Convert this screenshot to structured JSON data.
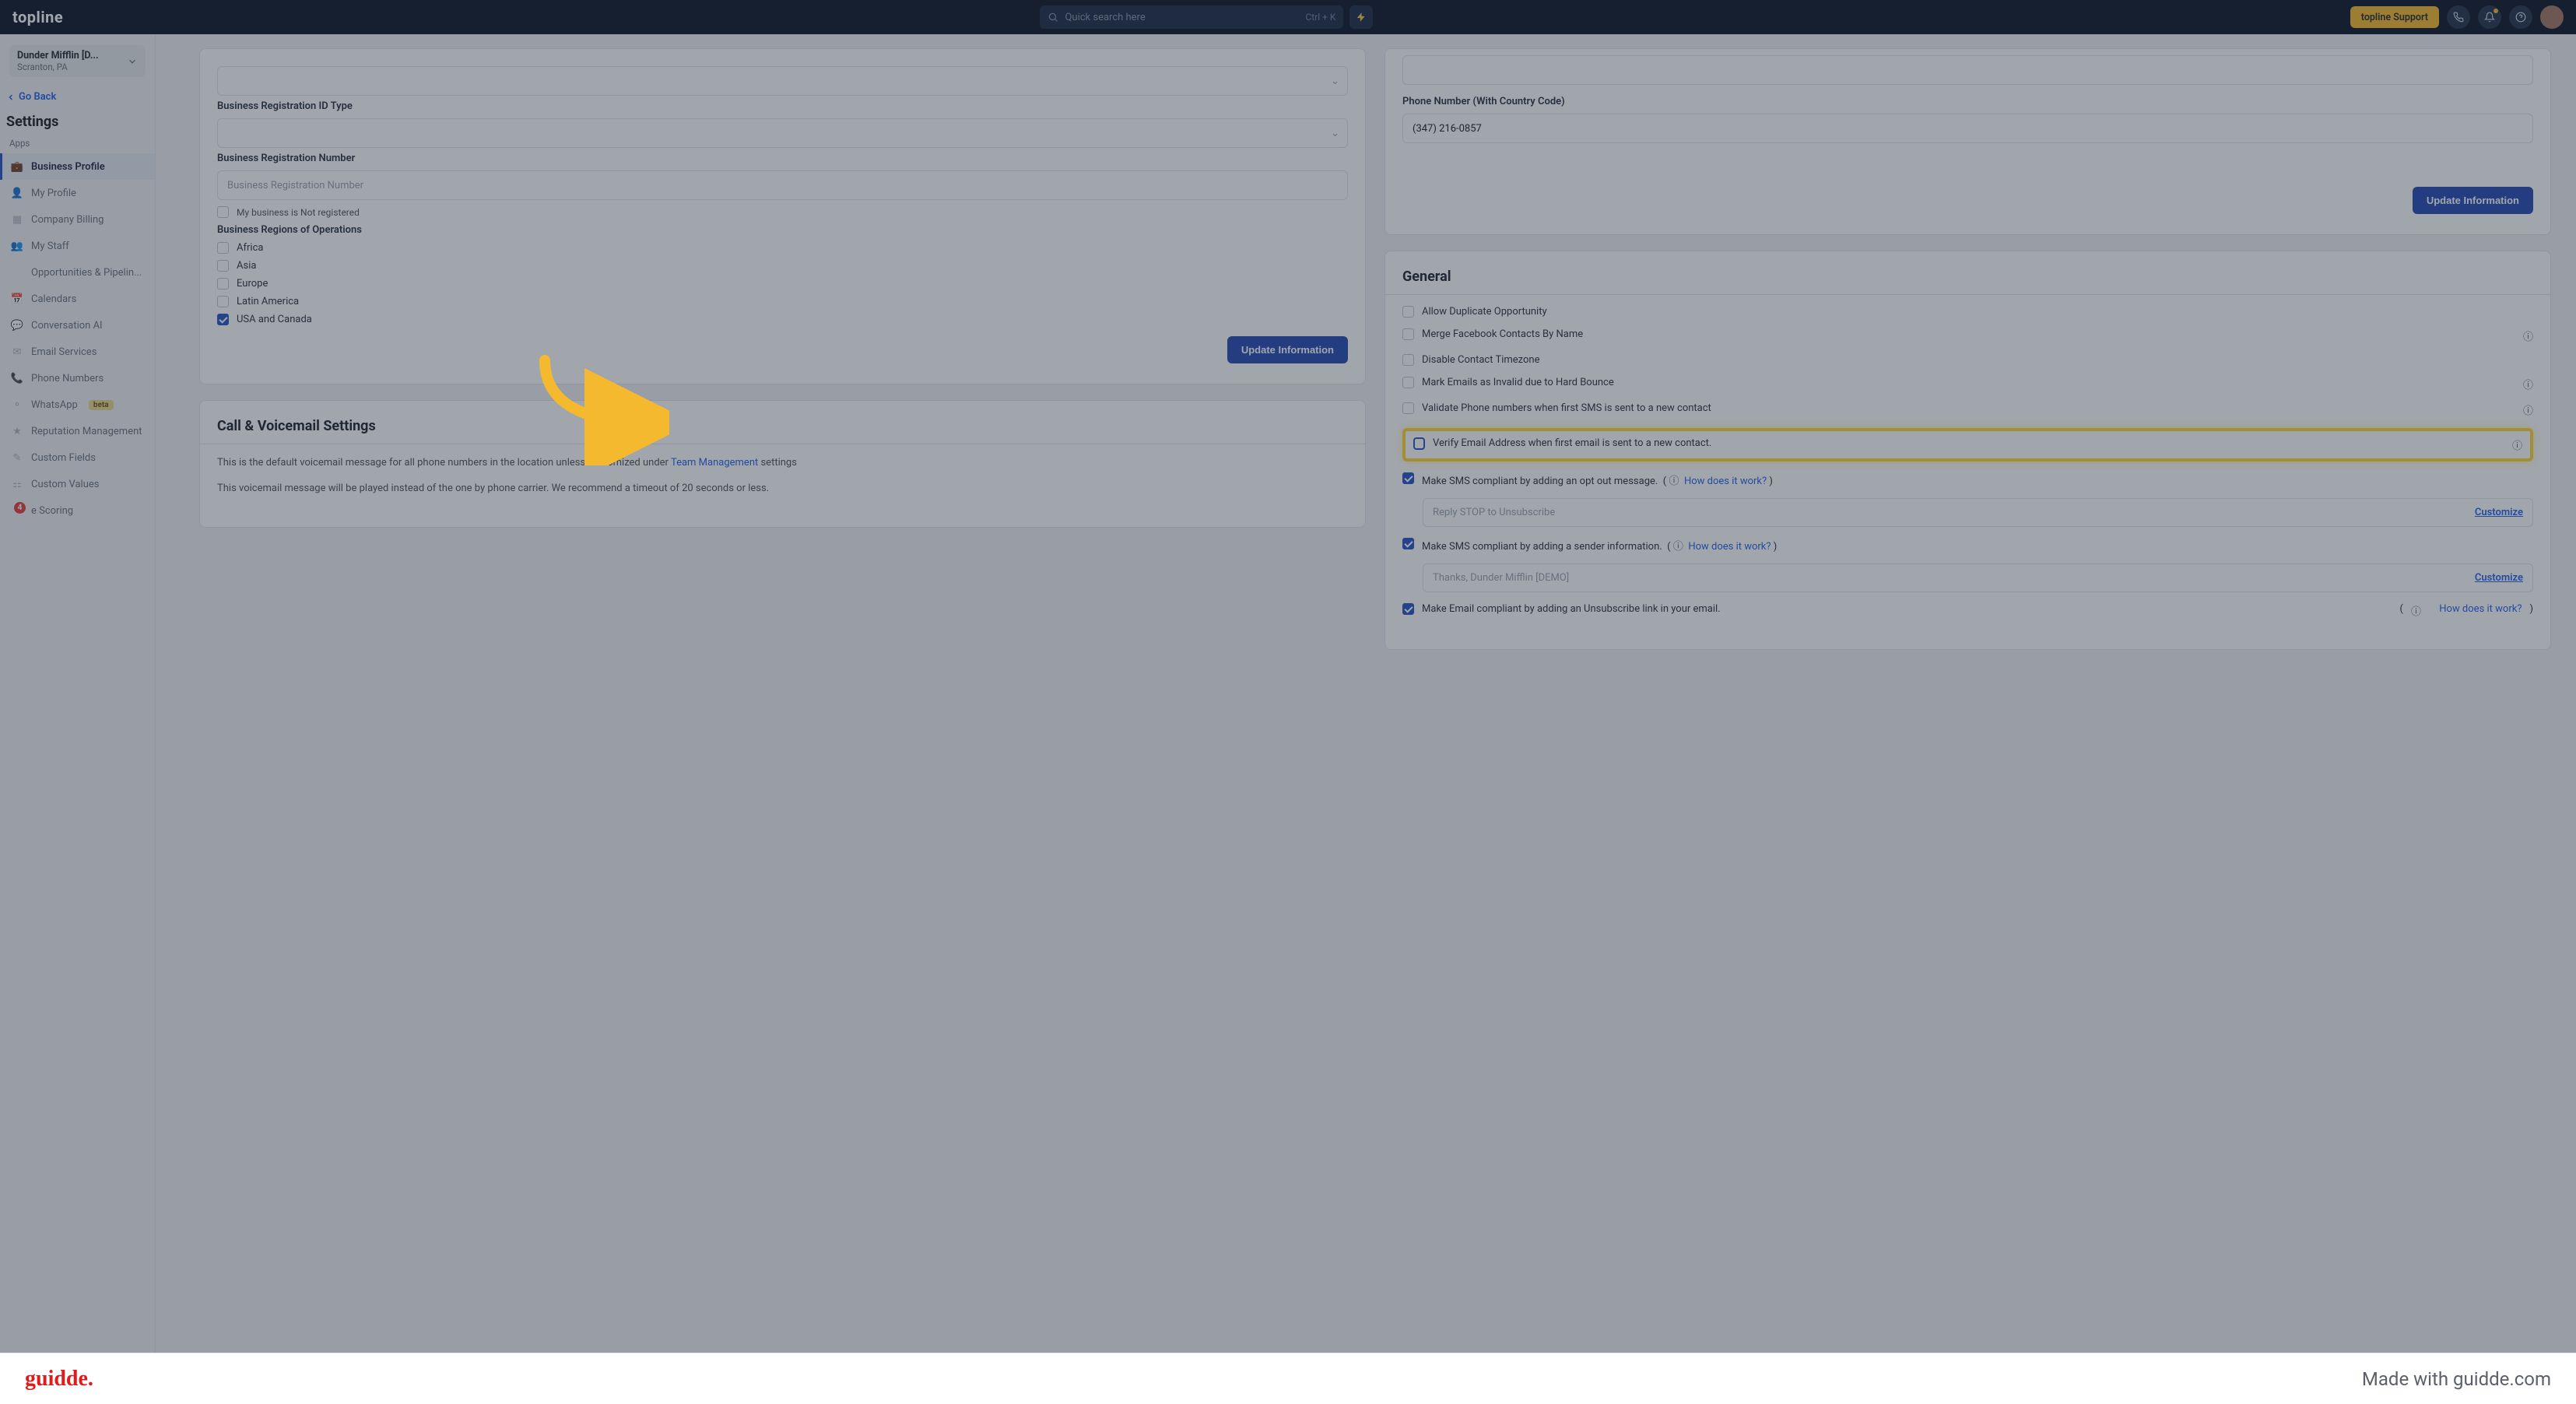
{
  "brand": "topline",
  "search": {
    "placeholder": "Quick search here",
    "shortcut": "Ctrl + K"
  },
  "supportLabel": "topline Support",
  "account": {
    "name": "Dunder Mifflin [D...",
    "location": "Scranton, PA"
  },
  "goBack": "Go Back",
  "settingsTitle": "Settings",
  "sidebar": {
    "section": "Apps",
    "items": [
      {
        "label": "Business Profile",
        "active": true
      },
      {
        "label": "My Profile"
      },
      {
        "label": "Company Billing"
      },
      {
        "label": "My Staff"
      },
      {
        "label": "Opportunities & Pipelin..."
      },
      {
        "label": "Calendars"
      },
      {
        "label": "Conversation AI"
      },
      {
        "label": "Email Services"
      },
      {
        "label": "Phone Numbers"
      },
      {
        "label": "WhatsApp",
        "badge": "beta"
      },
      {
        "label": "Reputation Management"
      },
      {
        "label": "Custom Fields"
      },
      {
        "label": "Custom Values"
      },
      {
        "label": "e Scoring",
        "pill": "4"
      }
    ]
  },
  "left": {
    "bizIdType": "Business Registration ID Type",
    "bizRegNum": "Business Registration Number",
    "bizRegPh": "Business Registration Number",
    "notReg": "My business is Not registered",
    "regionsLabel": "Business Regions of Operations",
    "regions": [
      {
        "label": "Africa",
        "checked": false
      },
      {
        "label": "Asia",
        "checked": false
      },
      {
        "label": "Europe",
        "checked": false
      },
      {
        "label": "Latin America",
        "checked": false
      },
      {
        "label": "USA and Canada",
        "checked": true
      }
    ],
    "updateBtn": "Update Information",
    "callTitle": "Call & Voicemail Settings",
    "callP1a": "This is the default voicemail message for all phone numbers in the location unless customized under ",
    "callLink": "Team Management",
    "callP1b": " settings",
    "callP2": "This voicemail message will be played instead of the one by phone carrier. We recommend a timeout of 20 seconds or less."
  },
  "right": {
    "phoneLabel": "Phone Number (With Country Code)",
    "phoneValue": "(347) 216-0857",
    "updateBtn": "Update Information",
    "generalTitle": "General",
    "opts": {
      "dup": "Allow Duplicate Opportunity",
      "merge": "Merge Facebook Contacts By Name",
      "tz": "Disable Contact Timezone",
      "bounce": "Mark Emails as Invalid due to Hard Bounce",
      "validate": "Validate Phone numbers when first SMS is sent to a new contact",
      "verify": "Verify Email Address when first email is sent to a new contact.",
      "smsOpt": "Make SMS compliant by adding an opt out message.",
      "smsOptPh": "Reply STOP to Unsubscribe",
      "smsSender": "Make SMS compliant by adding a sender information.",
      "smsSenderVal": "Thanks, Dunder Mifflin [DEMO]",
      "emailUnsub": "Make Email compliant by adding an Unsubscribe link in your email.",
      "how": "How does it work?",
      "customize": "Customize"
    }
  },
  "footer": {
    "logo": "guidde.",
    "made": "Made with guidde.com"
  }
}
